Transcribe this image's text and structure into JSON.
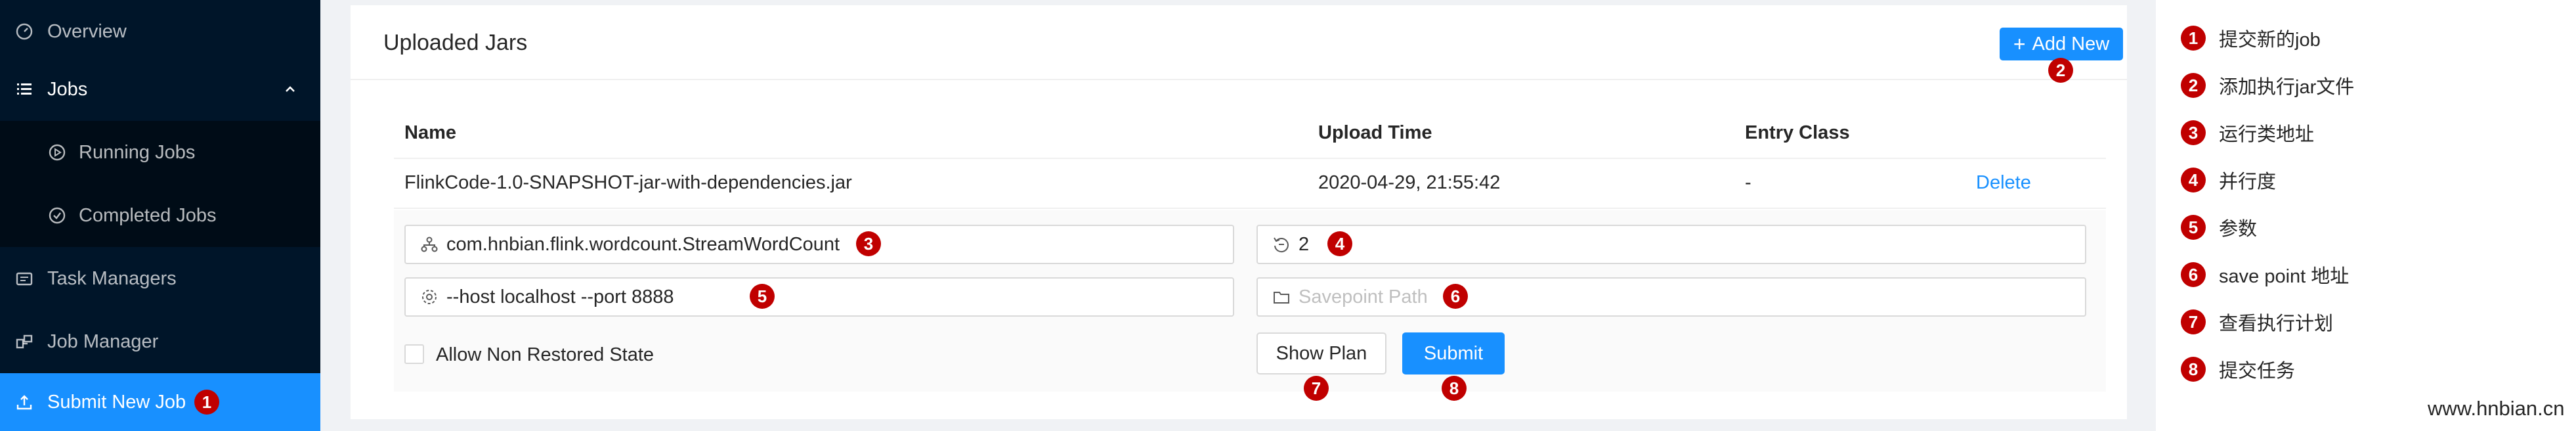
{
  "sidebar": {
    "items": [
      {
        "label": "Overview",
        "icon": "dashboard-icon"
      },
      {
        "label": "Jobs",
        "icon": "list-icon"
      },
      {
        "label": "Running Jobs",
        "icon": "play-circle-icon"
      },
      {
        "label": "Completed Jobs",
        "icon": "check-circle-icon"
      },
      {
        "label": "Task Managers",
        "icon": "schedule-icon"
      },
      {
        "label": "Job Manager",
        "icon": "build-icon"
      },
      {
        "label": "Submit New Job",
        "icon": "upload-icon"
      }
    ]
  },
  "card": {
    "title": "Uploaded Jars",
    "add_button": "Add New"
  },
  "table": {
    "columns": [
      "Name",
      "Upload Time",
      "Entry Class"
    ],
    "rows": [
      {
        "name": "FlinkCode-1.0-SNAPSHOT-jar-with-dependencies.jar",
        "upload_time": "2020-04-29, 21:55:42",
        "entry_class": "-",
        "action": "Delete"
      }
    ]
  },
  "form": {
    "entry_class": "com.hnbian.flink.wordcount.StreamWordCount",
    "parallelism": "2",
    "program_args": "--host localhost --port 8888",
    "savepoint_placeholder": "Savepoint Path",
    "allow_non_restored": "Allow Non Restored State",
    "allow_non_restored_checked": false,
    "show_plan": "Show Plan",
    "submit": "Submit"
  },
  "markers": [
    "1",
    "2",
    "3",
    "4",
    "5",
    "6",
    "7",
    "8"
  ],
  "legend": [
    {
      "num": "1",
      "text": "提交新的job"
    },
    {
      "num": "2",
      "text": "添加执行jar文件"
    },
    {
      "num": "3",
      "text": "运行类地址"
    },
    {
      "num": "4",
      "text": "并行度"
    },
    {
      "num": "5",
      "text": "参数"
    },
    {
      "num": "6",
      "text": "save point 地址"
    },
    {
      "num": "7",
      "text": "查看执行计划"
    },
    {
      "num": "8",
      "text": "提交任务"
    }
  ],
  "watermark": "www.hnbian.cn",
  "colors": {
    "sidebar": "#001529",
    "accent": "#1890ff",
    "marker": "#c00000"
  }
}
